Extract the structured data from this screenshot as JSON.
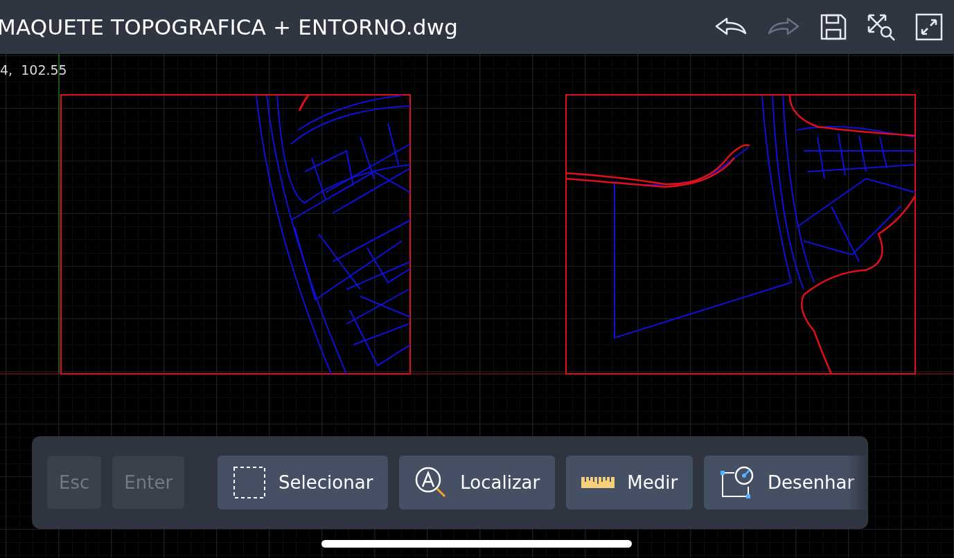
{
  "title": "MAQUETE TOPOGRAFICA + ENTORNO.dwg",
  "actions": [
    {
      "kind": "undo",
      "disabled": false
    },
    {
      "kind": "redo",
      "disabled": true
    },
    {
      "kind": "save",
      "disabled": false
    },
    {
      "kind": "zoom-extents",
      "disabled": false
    },
    {
      "kind": "fullscreen",
      "disabled": false
    }
  ],
  "coordinates": "4,  102.55",
  "keys": [
    {
      "label": "Esc",
      "disabled": true
    },
    {
      "label": "Enter",
      "disabled": true
    }
  ],
  "tools": [
    {
      "kind": "select",
      "label": "Selecionar"
    },
    {
      "kind": "find",
      "label": "Localizar"
    },
    {
      "kind": "measure",
      "label": "Medir"
    },
    {
      "kind": "draw",
      "label": "Desenhar"
    }
  ]
}
